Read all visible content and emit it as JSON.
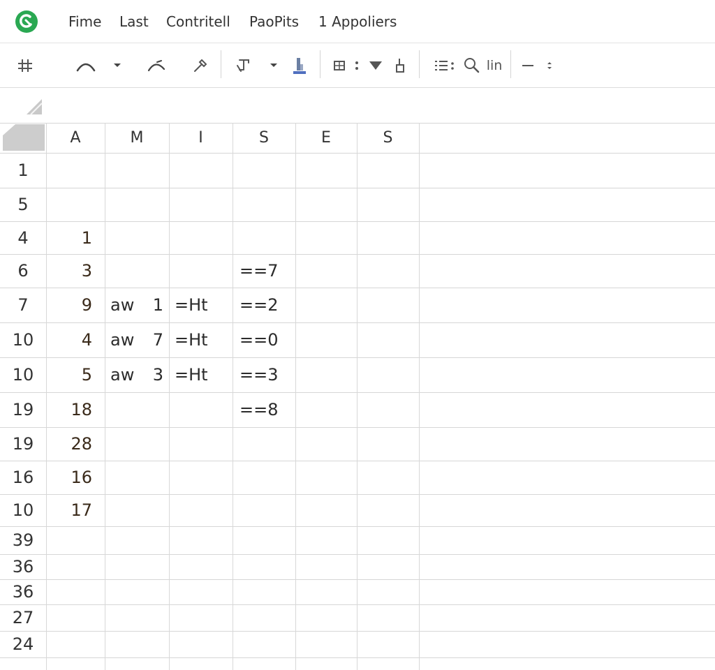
{
  "menu": [
    "Fime",
    "Last",
    "Contritell",
    "PaoPits",
    "1 Appoliers"
  ],
  "toolbar": {
    "zoom_label": "lin"
  },
  "colors": {
    "brand": "#2aa852",
    "grid_line": "#d6d6d6",
    "header_bg": "#ffffff",
    "select_all": "#c8c8c8"
  },
  "sheet": {
    "columns": [
      "A",
      "M",
      "I",
      "S",
      "E",
      "S"
    ],
    "rows": [
      {
        "num": "1",
        "a": "",
        "m1": "",
        "m2": "",
        "i": "",
        "s": ""
      },
      {
        "num": "5",
        "a": "",
        "m1": "",
        "m2": "",
        "i": "",
        "s": ""
      },
      {
        "num": "4",
        "a": "1",
        "m1": "",
        "m2": "",
        "i": "",
        "s": ""
      },
      {
        "num": "6",
        "a": "3",
        "m1": "",
        "m2": "",
        "i": "",
        "s": "==7"
      },
      {
        "num": "7",
        "a": "9",
        "m1": "aw",
        "m2": "1",
        "i": "=Ht",
        "s": "==2"
      },
      {
        "num": "10",
        "a": "4",
        "m1": "aw",
        "m2": "7",
        "i": "=Ht",
        "s": "==0"
      },
      {
        "num": "10",
        "a": "5",
        "m1": "aw",
        "m2": "3",
        "i": "=Ht",
        "s": "==3"
      },
      {
        "num": "19",
        "a": "18",
        "m1": "",
        "m2": "",
        "i": "",
        "s": "==8"
      },
      {
        "num": "19",
        "a": "28",
        "m1": "",
        "m2": "",
        "i": "",
        "s": ""
      },
      {
        "num": "16",
        "a": "16",
        "m1": "",
        "m2": "",
        "i": "",
        "s": ""
      },
      {
        "num": "10",
        "a": "17",
        "m1": "",
        "m2": "",
        "i": "",
        "s": ""
      },
      {
        "num": "39",
        "a": "",
        "m1": "",
        "m2": "",
        "i": "",
        "s": ""
      },
      {
        "num": "36",
        "a": "",
        "m1": "",
        "m2": "",
        "i": "",
        "s": ""
      },
      {
        "num": "36",
        "a": "",
        "m1": "",
        "m2": "",
        "i": "",
        "s": ""
      },
      {
        "num": "27",
        "a": "",
        "m1": "",
        "m2": "",
        "i": "",
        "s": ""
      },
      {
        "num": "24",
        "a": "",
        "m1": "",
        "m2": "",
        "i": "",
        "s": ""
      },
      {
        "num": "",
        "a": "",
        "m1": "",
        "m2": "",
        "i": "",
        "s": ""
      }
    ]
  }
}
